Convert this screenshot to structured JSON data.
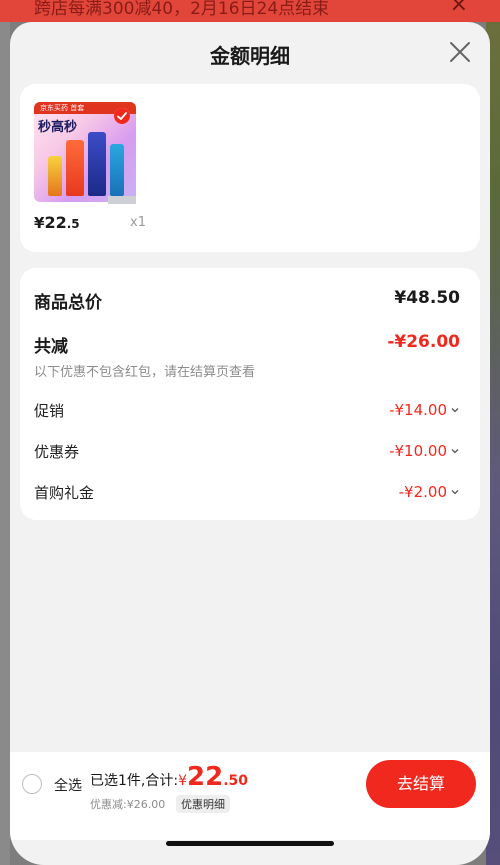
{
  "background": {
    "banner_text": "跨店每满300减40，2月16日24点结束"
  },
  "sheet": {
    "title": "金额明细"
  },
  "product": {
    "thumb_tag": "京东买药 首套",
    "thumb_title": "秒高秒",
    "price_symbol": "¥",
    "price_int": "22",
    "price_dec": ".5",
    "quantity": "x1"
  },
  "details": {
    "total_label": "商品总价",
    "total_value": "¥48.50",
    "reduce_label": "共减",
    "reduce_value": "-¥26.00",
    "note": "以下优惠不包含红包，请在结算页查看",
    "items": [
      {
        "label": "促销",
        "value": "-¥14.00"
      },
      {
        "label": "优惠券",
        "value": "-¥10.00"
      },
      {
        "label": "首购礼金",
        "value": "-¥2.00"
      }
    ]
  },
  "bottom": {
    "select_all": "全选",
    "summary_prefix": "已选1件,合计:",
    "yen": "¥",
    "amount_int": "22",
    "amount_dec": ".50",
    "discount_text": "优惠减:¥26.00",
    "detail_toggle": "优惠明细",
    "checkout": "去结算"
  },
  "colors": {
    "accent": "#f0281e",
    "sheet_bg": "#f2f2f2",
    "card_bg": "#ffffff"
  },
  "icons": {
    "close": "close-icon",
    "chevron": "chevron-down-icon",
    "check": "check-icon"
  }
}
